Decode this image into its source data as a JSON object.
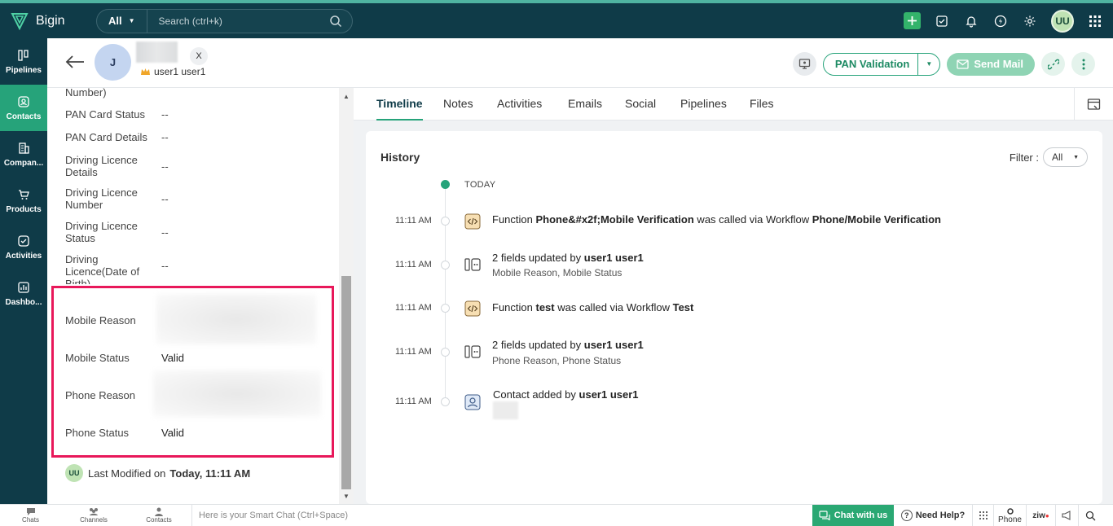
{
  "app": {
    "name": "Bigin"
  },
  "search": {
    "scope": "All",
    "placeholder": "Search (ctrl+k)"
  },
  "topbar": {
    "user_initials": "UU"
  },
  "nav": [
    {
      "label": "Pipelines",
      "icon": "pipelines-icon"
    },
    {
      "label": "Contacts",
      "icon": "contacts-icon",
      "active": true
    },
    {
      "label": "Compan...",
      "icon": "companies-icon"
    },
    {
      "label": "Products",
      "icon": "products-icon"
    },
    {
      "label": "Activities",
      "icon": "activities-icon"
    },
    {
      "label": "Dashbo...",
      "icon": "dashboards-icon"
    }
  ],
  "record": {
    "initial": "J",
    "owner": "user1 user1",
    "social": "X"
  },
  "header_actions": {
    "pan_label": "PAN Validation",
    "send_mail_label": "Send Mail"
  },
  "details": {
    "partial_top": "Number)",
    "fields": [
      {
        "label": "PAN Card Status",
        "value": "--"
      },
      {
        "label": "PAN Card Details",
        "value": "--"
      },
      {
        "label": "Driving Licence Details",
        "value": "--"
      },
      {
        "label": "Driving Licence Number",
        "value": "--"
      },
      {
        "label": "Driving Licence Status",
        "value": "--"
      },
      {
        "label": "Driving Licence(Date of Birth)",
        "value": "--"
      }
    ],
    "highlighted": [
      {
        "label": "Mobile Reason",
        "value": ""
      },
      {
        "label": "Mobile Status",
        "value": "Valid"
      },
      {
        "label": "Phone Reason",
        "value": ""
      },
      {
        "label": "Phone Status",
        "value": "Valid"
      }
    ],
    "last_modified": {
      "initials": "UU",
      "label": "Last Modified on",
      "value": "Today, 11:11 AM"
    }
  },
  "tabs": [
    "Timeline",
    "Notes",
    "Activities",
    "Emails",
    "Social",
    "Pipelines",
    "Files"
  ],
  "history": {
    "title": "History",
    "filter_label": "Filter :",
    "filter_value": "All",
    "today_label": "TODAY",
    "entries": [
      {
        "time": "11:11 AM",
        "icon": "function-icon",
        "parts": [
          "Function ",
          "Phone&#x2f;Mobile Verification",
          " was called via Workflow ",
          "Phone/Mobile Verification"
        ],
        "sub": ""
      },
      {
        "time": "11:11 AM",
        "icon": "field-update-icon",
        "parts": [
          "2 fields updated by ",
          "user1 user1",
          "",
          ""
        ],
        "sub": "Mobile Reason, Mobile Status"
      },
      {
        "time": "11:11 AM",
        "icon": "function-icon",
        "parts": [
          "Function ",
          "test",
          " was called via Workflow ",
          "Test"
        ],
        "sub": ""
      },
      {
        "time": "11:11 AM",
        "icon": "field-update-icon",
        "parts": [
          "2 fields updated by ",
          "user1 user1",
          "",
          ""
        ],
        "sub": "Phone Reason, Phone Status"
      },
      {
        "time": "11:11 AM",
        "icon": "contact-added-icon",
        "parts": [
          "Contact added by ",
          "user1 user1",
          "",
          ""
        ],
        "sub": ""
      }
    ]
  },
  "bottombar": {
    "items": [
      "Chats",
      "Channels",
      "Contacts"
    ],
    "smartchat_placeholder": "Here is your Smart Chat (Ctrl+Space)",
    "chat_label": "Chat with us",
    "help_label": "Need Help?",
    "phone_label": "Phone",
    "ziwo_label": "ziw"
  }
}
